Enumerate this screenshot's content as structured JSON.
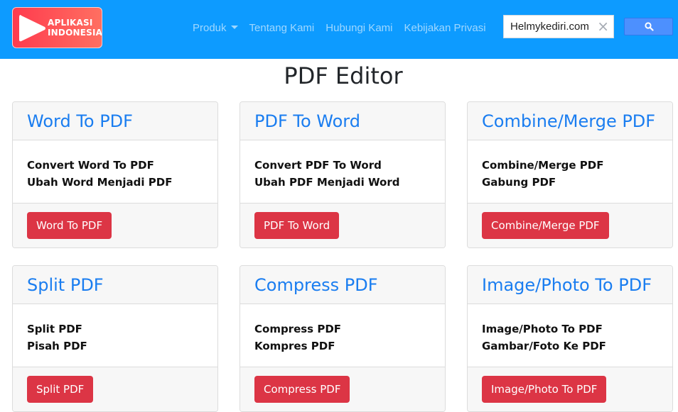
{
  "brand": {
    "logo_line1": "APLIKASI",
    "logo_line2": "INDONESIA"
  },
  "nav": {
    "items": [
      {
        "label": "Produk"
      },
      {
        "label": "Tentang Kami"
      },
      {
        "label": "Hubungi Kami"
      },
      {
        "label": "Kebijakan Privasi"
      }
    ]
  },
  "search": {
    "value": "Helmykediri.com",
    "clear_symbol": "×"
  },
  "page": {
    "title": "PDF Editor"
  },
  "cards": [
    {
      "title": "Word To PDF",
      "line1": "Convert Word To PDF",
      "line2": "Ubah Word Menjadi PDF",
      "button": "Word To PDF"
    },
    {
      "title": "PDF To Word",
      "line1": "Convert PDF To Word",
      "line2": "Ubah PDF Menjadi Word",
      "button": "PDF To Word"
    },
    {
      "title": "Combine/Merge PDF",
      "line1": "Combine/Merge PDF",
      "line2": "Gabung PDF",
      "button": "Combine/Merge PDF"
    },
    {
      "title": "Split PDF",
      "line1": "Split PDF",
      "line2": "Pisah PDF",
      "button": "Split PDF"
    },
    {
      "title": "Compress PDF",
      "line1": "Compress PDF",
      "line2": "Kompres PDF",
      "button": "Compress PDF"
    },
    {
      "title": "Image/Photo To PDF",
      "line1": "Image/Photo To PDF",
      "line2": "Gambar/Foto Ke PDF",
      "button": "Image/Photo To PDF"
    }
  ],
  "colors": {
    "navbar": "#0d9bff",
    "link": "#1a7df0",
    "button": "#dc3545",
    "search_button": "#4d90fe"
  },
  "icons": {
    "logo": "play-icon",
    "search": "search-icon",
    "dropdown": "caret-down-icon"
  }
}
